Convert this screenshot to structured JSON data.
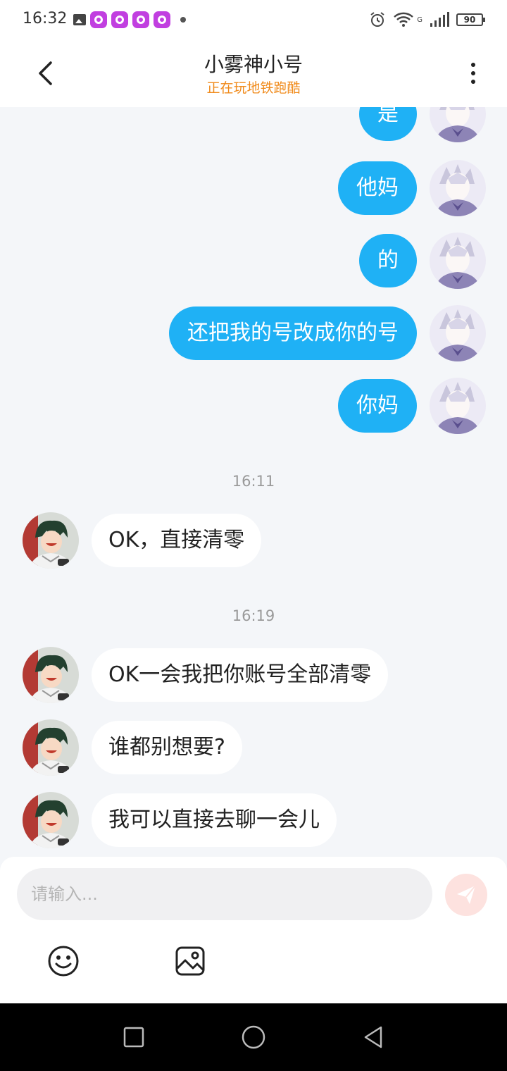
{
  "status_bar": {
    "time": "16:32",
    "network": "G",
    "battery": "90"
  },
  "header": {
    "title": "小雾神小号",
    "status": "正在玩地铁跑酷"
  },
  "outgoing_messages": [
    {
      "text": "是"
    },
    {
      "text": "他妈"
    },
    {
      "text": "的"
    },
    {
      "text": "还把我的号改成你的号"
    },
    {
      "text": "你妈"
    }
  ],
  "time_separators": [
    "16:11",
    "16:19"
  ],
  "incoming_messages": [
    {
      "text": "OK，直接清零"
    },
    {
      "text": "OK一会我把你账号全部清零"
    },
    {
      "text": "谁都别想要?"
    },
    {
      "text": "我可以直接去聊一会儿"
    }
  ],
  "input": {
    "placeholder": "请输入..."
  },
  "colors": {
    "accent": "#1fb1f5",
    "status_orange": "#f08a1a",
    "send_inactive": "#fde2df"
  },
  "icons": [
    "back-icon",
    "more-icon",
    "send-icon",
    "emoji-icon",
    "image-icon",
    "nav-recent-icon",
    "nav-home-icon",
    "nav-back-icon"
  ]
}
